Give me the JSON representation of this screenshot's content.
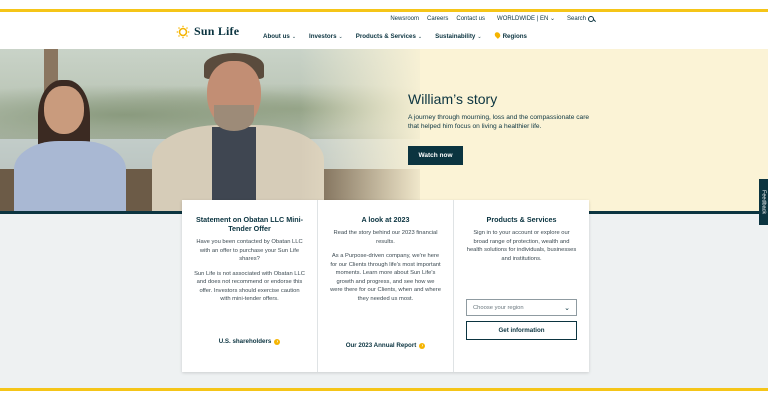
{
  "brand": {
    "name": "Sun Life"
  },
  "utility_nav": {
    "newsroom": "Newsroom",
    "careers": "Careers",
    "contact": "Contact us",
    "worldwide": "WORLDWIDE | EN",
    "search": "Search"
  },
  "main_nav": {
    "about": "About us",
    "investors": "Investors",
    "products": "Products & Services",
    "sustainability": "Sustainability",
    "regions": "Regions"
  },
  "hero": {
    "title": "William’s story",
    "description": "A journey through mourning, loss and the compassionate care that helped him focus on living a healthier life.",
    "button": "Watch now"
  },
  "cards": [
    {
      "title": "Statement on Obatan LLC Mini-Tender Offer",
      "paragraphs": [
        "Have you been contacted by Obatan LLC with an offer to purchase your Sun Life shares?",
        "Sun Life is not associated with Obatan LLC and does not recommend or endorse this offer. Investors should exercise caution with mini-tender offers."
      ],
      "link": "U.S. shareholders"
    },
    {
      "title": "A look at 2023",
      "paragraphs": [
        "Read the story behind our 2023 financial results.",
        "As a Purpose-driven company, we're here for our Clients through life's most important moments. Learn more about Sun Life's growth and progress, and see how we were there for our Clients, when and where they needed us most."
      ],
      "link": "Our 2023 Annual Report"
    },
    {
      "title": "Products & Services",
      "paragraphs": [
        "Sign in to your account or explore our broad range of protection, wealth and health solutions for individuals, businesses and institutions."
      ],
      "select_placeholder": "Choose your region",
      "button": "Get information"
    }
  ],
  "feedback": "Feedback",
  "colors": {
    "accent": "#f5c518",
    "navy": "#0b3440",
    "hero_bg": "#fbf3d6"
  }
}
